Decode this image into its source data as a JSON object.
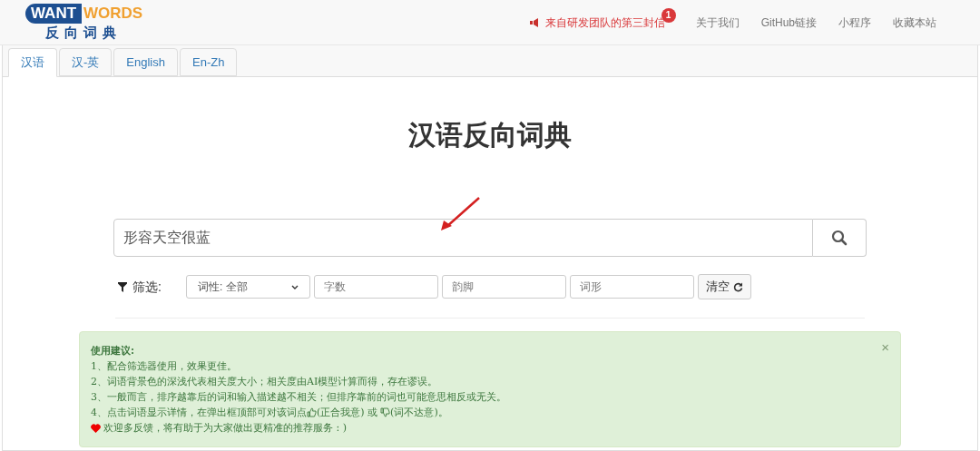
{
  "logo": {
    "word_1": "WANT",
    "word_2": "WORDS",
    "subtitle": "反向词典"
  },
  "nav": [
    {
      "kind": "letter",
      "label": "来自研发团队的第三封信",
      "badge": "1"
    },
    {
      "kind": "link",
      "label": "关于我们"
    },
    {
      "kind": "link",
      "label": "GitHub链接"
    },
    {
      "kind": "link",
      "label": "小程序"
    },
    {
      "kind": "link",
      "label": "收藏本站"
    }
  ],
  "tabs": [
    {
      "label": "汉语",
      "selected": true
    },
    {
      "label": "汉-英",
      "selected": false
    },
    {
      "label": "English",
      "selected": false
    },
    {
      "label": "En-Zh",
      "selected": false
    }
  ],
  "title": "汉语反向词典",
  "search": {
    "value": "形容天空很蓝"
  },
  "filter": {
    "label": "筛选:",
    "select": "词性: 全部",
    "fields": [
      {
        "placeholder": "字数"
      },
      {
        "placeholder": "韵脚"
      },
      {
        "placeholder": "词形"
      }
    ],
    "clear_button": "清空"
  },
  "tips": {
    "title": "使用建议:",
    "close": "×",
    "lines": [
      {
        "kind": "text",
        "text": "1、配合筛选器使用，效果更佳。"
      },
      {
        "kind": "text",
        "text": "2、词语背景色的深浅代表相关度大小；相关度由AI模型计算而得，存在谬误。"
      },
      {
        "kind": "text",
        "text": "3、一般而言，排序越靠后的词和输入描述越不相关；但排序靠前的词也可能意思相反或无关。"
      },
      {
        "kind": "feedback",
        "parts": [
          "4、点击词语显示详情，在弹出框顶部可对该词点",
          "(正合我意) 或",
          "(词不达意)。"
        ]
      },
      {
        "kind": "heart",
        "text": "欢迎多反馈，将有助于为大家做出更精准的推荐服务 : )"
      }
    ]
  }
}
